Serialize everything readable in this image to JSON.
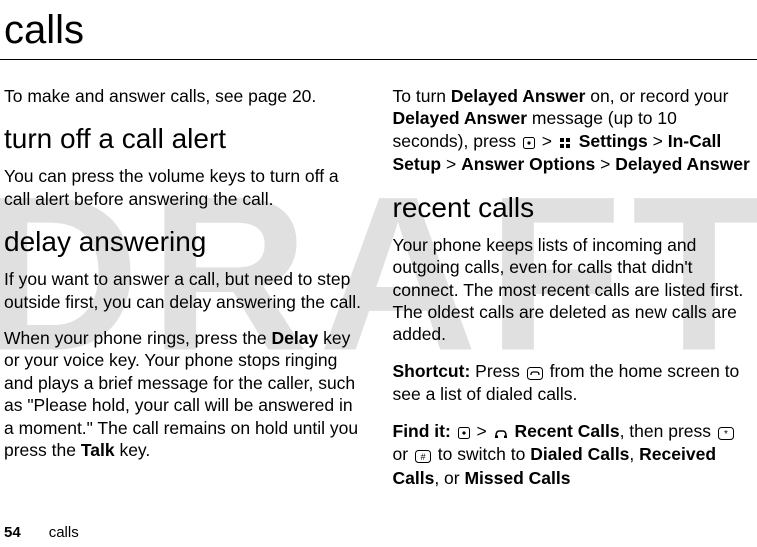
{
  "watermark": "DRAFT",
  "page_title": "calls",
  "left": {
    "p1": "To make and answer calls, see page 20.",
    "h1": "turn off a call alert",
    "p2": "You can press the volume keys to turn off a call alert before answering the call.",
    "h2": "delay answering",
    "p3": "If you want to answer a call, but need to step outside first, you can delay answering the call.",
    "p4_a": "When your phone rings, press the ",
    "p4_delay": "Delay",
    "p4_b": " key or your voice key. Your phone stops ringing and plays a brief message for the caller, such as \"Please hold, your call will be answered in a moment.\" The call remains on hold until you press the ",
    "p4_talk": "Talk",
    "p4_c": " key."
  },
  "right": {
    "p1_a": "To turn ",
    "p1_da1": "Delayed Answer",
    "p1_b": " on, or record your ",
    "p1_da2": "Delayed Answer",
    "p1_c": " message (up to 10 seconds), press ",
    "p1_gt1": " > ",
    "p1_settings": "Settings",
    "p1_gt2": " > ",
    "p1_incall": "In-Call Setup",
    "p1_gt3": " > ",
    "p1_ansopt": "Answer Options",
    "p1_gt4": " > ",
    "p1_da3": "Delayed Answer",
    "h1": "recent calls",
    "p2": "Your phone keeps lists of incoming and outgoing calls, even for calls that didn't connect. The most recent calls are listed first. The oldest calls are deleted as new calls are added.",
    "p3_a": "Shortcut:",
    "p3_b": " Press ",
    "p3_c": " from the home screen to see a list of dialed calls.",
    "p4_a": "Find it:",
    "p4_gt1": " > ",
    "p4_recent": "Recent Calls",
    "p4_b": ", then press ",
    "p4_or": " or ",
    "p4_c": " to switch to ",
    "p4_dialed": "Dialed Calls",
    "p4_d": ", ",
    "p4_received": "Received Calls",
    "p4_e": ", or ",
    "p4_missed": "Missed Calls"
  },
  "footer": {
    "page": "54",
    "section": "calls"
  }
}
